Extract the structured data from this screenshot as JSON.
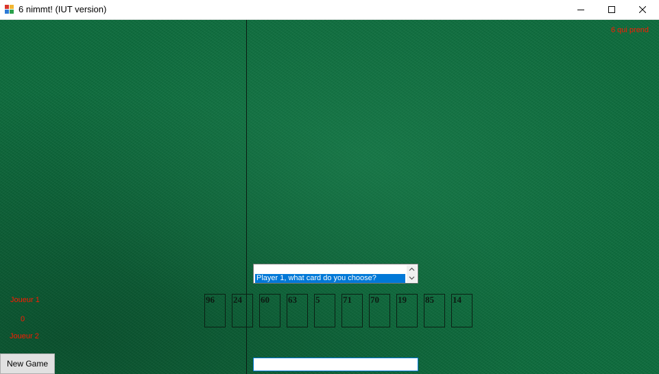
{
  "window": {
    "title": "6 nimmt! (IUT version)",
    "minimize_icon": "minimize-icon",
    "maximize_icon": "maximize-icon",
    "close_icon": "close-icon"
  },
  "table": {
    "corner_label": "6 qui prend",
    "player1_label": "Joueur 1",
    "score": "0",
    "player2_label": "Joueur 2"
  },
  "prompt_list": {
    "items": [
      "",
      "Player 1, what card do you choose?"
    ],
    "selected_index": 1
  },
  "hand": {
    "cards": [
      "96",
      "24",
      "60",
      "63",
      "5",
      "71",
      "70",
      "19",
      "85",
      "14"
    ]
  },
  "controls": {
    "new_game_label": "New Game",
    "input_value": ""
  },
  "colors": {
    "felt": "#0c6b3c",
    "label_red": "#ff1a00",
    "selection": "#0078d7"
  }
}
